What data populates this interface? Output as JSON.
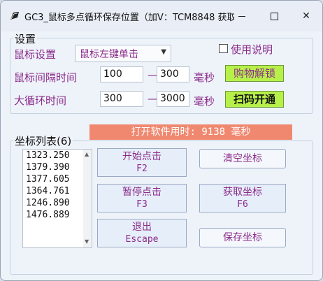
{
  "window": {
    "title": "GC3_鼠标多点循环保存位置（加V：TCM8848 获取...",
    "close_glyph": "✕"
  },
  "settings": {
    "group_label": "设置",
    "mouse_setting_label": "鼠标设置",
    "mouse_mode_value": "鼠标左键单击",
    "dropdown_arrow": "▼",
    "help_label": "使用说明",
    "interval_label": "鼠标间隔时间",
    "interval_min": "100",
    "interval_max": "300",
    "interval_unit": "毫秒",
    "loop_label": "大循环时间",
    "loop_min": "300",
    "loop_max": "3000",
    "loop_unit": "毫秒",
    "range_dash": "—",
    "buy_unlock_label": "购物解锁",
    "scan_label": "扫码开通"
  },
  "timer": {
    "text": "打开软件用时: 9138 毫秒"
  },
  "coords": {
    "group_label": "坐标列表(6)",
    "items": [
      "1323.250",
      "1379.390",
      "1377.605",
      "1364.761",
      "1246.890",
      "1476.889"
    ],
    "scroll_up": "▲",
    "scroll_down": "▼"
  },
  "buttons": {
    "start": {
      "label": "开始点击",
      "key": "F2"
    },
    "pause": {
      "label": "暂停点击",
      "key": "F3"
    },
    "exit": {
      "label": "退出",
      "key": "Escape"
    },
    "clear": {
      "label": "清空坐标"
    },
    "get": {
      "label": "获取坐标",
      "key": "F6"
    },
    "save": {
      "label": "保存坐标"
    }
  }
}
